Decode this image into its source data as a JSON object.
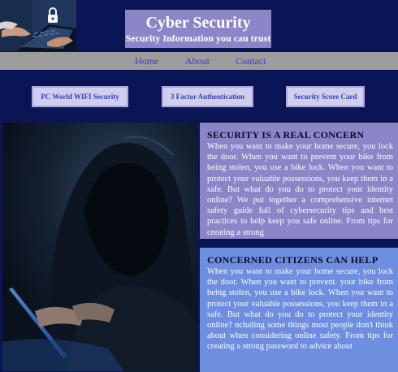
{
  "header": {
    "title": "Cyber Security",
    "subtitle": "Security Information you can trust"
  },
  "nav": {
    "items": [
      {
        "label": "Home"
      },
      {
        "label": "About"
      },
      {
        "label": "Contact"
      }
    ]
  },
  "features": {
    "buttons": [
      {
        "label": "PC World WIFI Security"
      },
      {
        "label": "3 Factor Authentication"
      },
      {
        "label": "Security Score Card"
      }
    ]
  },
  "sections": [
    {
      "heading": "SECURITY IS A REAL CONCERN",
      "body": "When you want to make your home secure, you lock the door. When you want to prevent your bike from being stolen, you use a bike lock. When you want to protect your valuable possessions, you keep them in a safe. But what do you do to protect your identity online? We put together a comprehensive internet safety guide full of cybersecurity tips and best practices to help keep you safe online. From tips for creating a strong"
    },
    {
      "heading": "CONCERNED CITIZENS CAN HELP",
      "body": "When you want to make your home secure, you lock the door. When you want to prevent. your bike from being stolen, you use a bike lock. When you want to protect your valuable possessions, you keep them in a safe. But what do you do to protect your identity online? ncluding some things most people don't think about when considering online safety. From tips for creating a strong password to advice about"
    }
  ],
  "colors": {
    "page_background": "#0b1555",
    "title_box": "#8a86c8",
    "nav_bar": "#9c9c9c",
    "nav_link": "#3b3bd6",
    "button_background": "#cfcfec",
    "section_one": "#8a86c8",
    "section_two": "#6e8ee0"
  },
  "images": {
    "header": "hands-typing-laptop-lock-icon",
    "hero": "hooded-hacker-laptop"
  }
}
